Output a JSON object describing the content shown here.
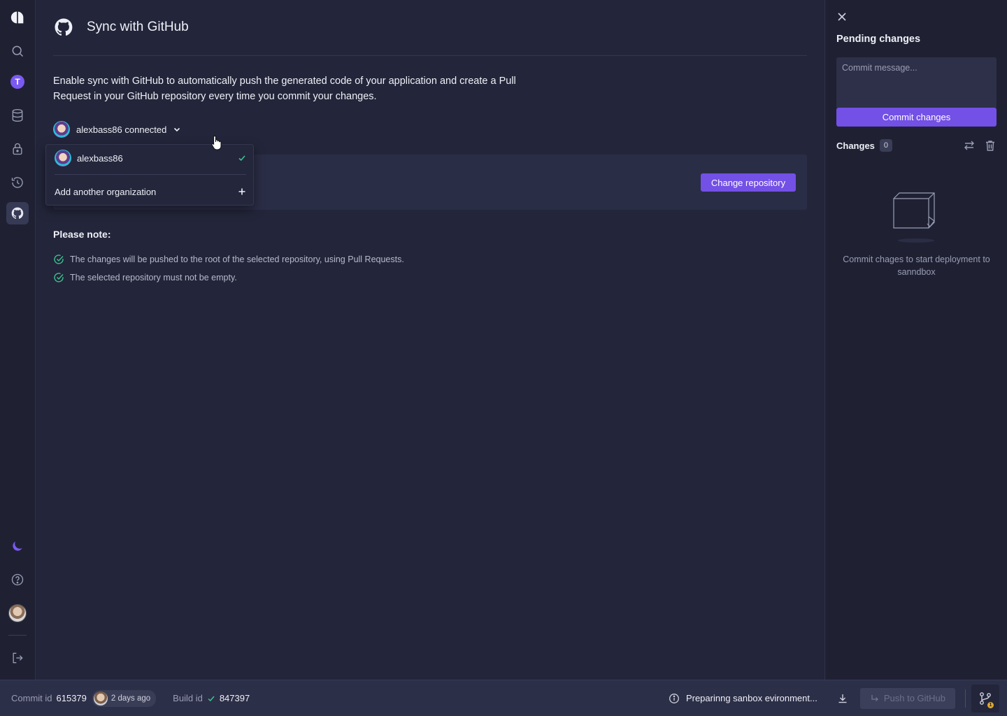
{
  "header": {
    "title": "Sync with GitHub"
  },
  "main": {
    "description": "Enable sync with GitHub to automatically push the generated code of your application and create a Pull Request in your GitHub repository every time you commit your changes.",
    "connection_label": "alexbass86 connected",
    "change_repo_label": "Change repository",
    "note_title": "Please note:",
    "notes": [
      "The changes will be pushed to the root of the selected repository, using Pull Requests.",
      "The selected repository must not be empty."
    ]
  },
  "dropdown": {
    "account": "alexbass86",
    "add_label": "Add another organization"
  },
  "rail": {
    "workspace_initial": "T"
  },
  "side": {
    "title": "Pending changes",
    "commit_placeholder": "Commit message...",
    "commit_button": "Commit changes",
    "changes_label": "Changes",
    "changes_count": "0",
    "empty_text": "Commit chages to start deployment to sanndbox"
  },
  "bottom": {
    "commit_label": "Commit id",
    "commit_value": "615379",
    "commit_time": "2 days ago",
    "build_label": "Build id",
    "build_value": "847397",
    "status_text": "Preparinng sanbox evironment...",
    "push_label": "Push to GitHub",
    "pending_badge": "1"
  },
  "colors": {
    "accent": "#7350e6",
    "success": "#3ec28f",
    "background": "#22243a"
  }
}
